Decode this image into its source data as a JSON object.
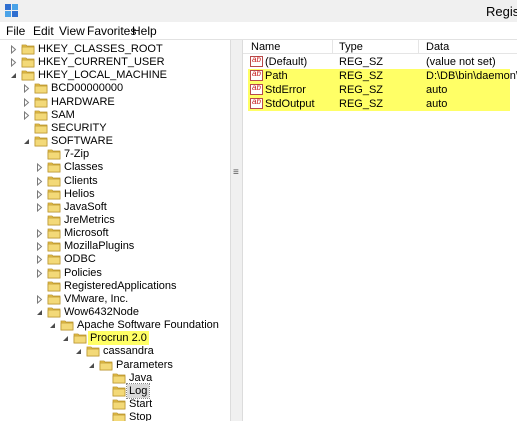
{
  "window": {
    "title": "Regis"
  },
  "menu": [
    "File",
    "Edit",
    "View",
    "Favorites",
    "Help"
  ],
  "tree": [
    {
      "label": "HKEY_CLASSES_ROOT",
      "toggle": "collapsed"
    },
    {
      "label": "HKEY_CURRENT_USER",
      "toggle": "collapsed"
    },
    {
      "label": "HKEY_LOCAL_MACHINE",
      "toggle": "expanded"
    },
    {
      "label": "BCD00000000",
      "toggle": "collapsed"
    },
    {
      "label": "HARDWARE",
      "toggle": "collapsed"
    },
    {
      "label": "SAM",
      "toggle": "collapsed"
    },
    {
      "label": "SECURITY",
      "toggle": "none"
    },
    {
      "label": "SOFTWARE",
      "toggle": "expanded"
    },
    {
      "label": "7-Zip",
      "toggle": "none"
    },
    {
      "label": "Classes",
      "toggle": "collapsed"
    },
    {
      "label": "Clients",
      "toggle": "collapsed"
    },
    {
      "label": "Helios",
      "toggle": "collapsed"
    },
    {
      "label": "JavaSoft",
      "toggle": "collapsed"
    },
    {
      "label": "JreMetrics",
      "toggle": "none"
    },
    {
      "label": "Microsoft",
      "toggle": "collapsed"
    },
    {
      "label": "MozillaPlugins",
      "toggle": "collapsed"
    },
    {
      "label": "ODBC",
      "toggle": "collapsed"
    },
    {
      "label": "Policies",
      "toggle": "collapsed"
    },
    {
      "label": "RegisteredApplications",
      "toggle": "none"
    },
    {
      "label": "VMware, Inc.",
      "toggle": "collapsed"
    },
    {
      "label": "Wow6432Node",
      "toggle": "expanded"
    },
    {
      "label": "Apache Software Foundation",
      "toggle": "expanded"
    },
    {
      "label": "Procrun 2.0",
      "toggle": "expanded",
      "highlight": true
    },
    {
      "label": "cassandra",
      "toggle": "expanded"
    },
    {
      "label": "Parameters",
      "toggle": "expanded"
    },
    {
      "label": "Java",
      "toggle": "none"
    },
    {
      "label": "Log",
      "toggle": "none",
      "selected": true
    },
    {
      "label": "Start",
      "toggle": "none"
    },
    {
      "label": "Stop",
      "toggle": "none"
    }
  ],
  "values_header": {
    "name": "Name",
    "type": "Type",
    "data": "Data"
  },
  "values": [
    {
      "icon": "string-value-icon",
      "icon_text": "ab",
      "name": "(Default)",
      "type": "REG_SZ",
      "data": "(value not set)",
      "highlight": false
    },
    {
      "icon": "string-value-icon",
      "icon_text": "ab",
      "name": "Path",
      "type": "REG_SZ",
      "data": "D:\\DB\\bin\\daemon\\",
      "highlight": true
    },
    {
      "icon": "string-value-icon",
      "icon_text": "ab",
      "name": "StdError",
      "type": "REG_SZ",
      "data": "auto",
      "highlight": true
    },
    {
      "icon": "string-value-icon",
      "icon_text": "ab",
      "name": "StdOutput",
      "type": "REG_SZ",
      "data": "auto",
      "highlight": true
    }
  ],
  "colors": {
    "highlight": "#ffff66",
    "folder": "#e8c34e",
    "icon_red": "#c81e1e"
  },
  "splitter_grip": "≡"
}
